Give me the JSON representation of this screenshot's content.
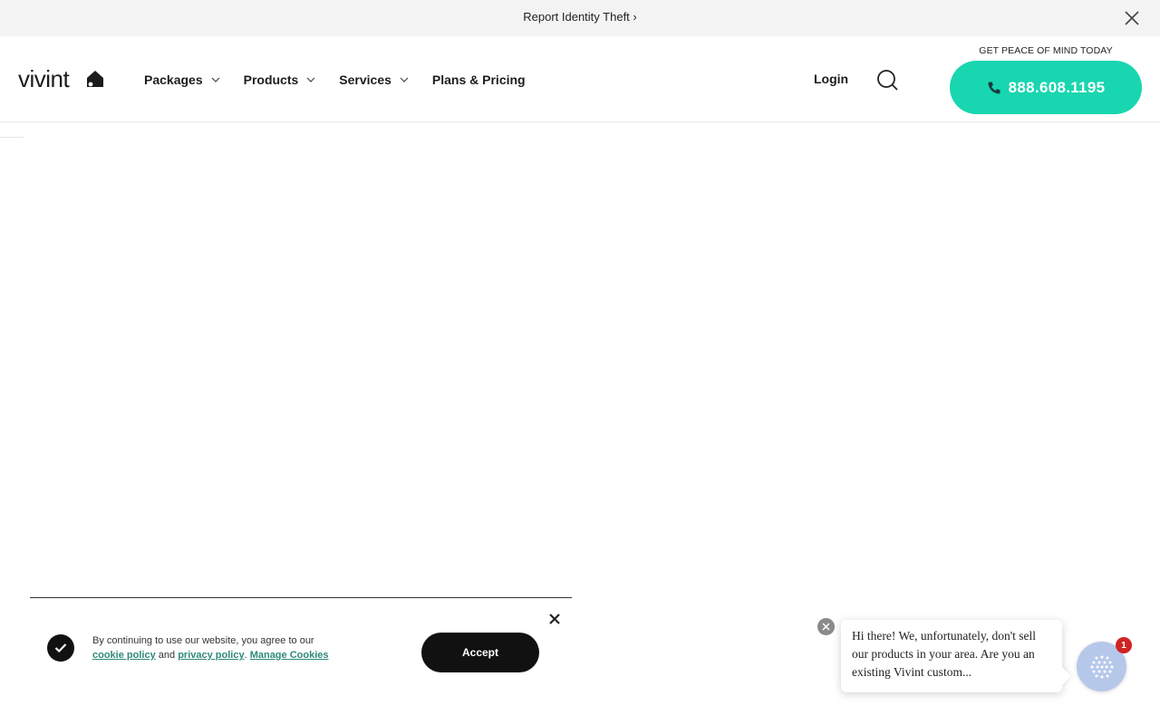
{
  "top_banner": {
    "link_text": "Report Identity Theft ›",
    "close_icon": "close-icon"
  },
  "header": {
    "logo_text": "vivint",
    "logo_icon": "house-icon",
    "nav": [
      {
        "label": "Packages",
        "has_dropdown": true
      },
      {
        "label": "Products",
        "has_dropdown": true
      },
      {
        "label": "Services",
        "has_dropdown": true
      },
      {
        "label": "Plans & Pricing",
        "has_dropdown": false
      }
    ],
    "login_label": "Login",
    "search_icon": "search-icon",
    "cta_label": "GET PEACE OF MIND TODAY",
    "phone_number": "888.608.1195",
    "phone_icon": "phone-icon"
  },
  "cookie_banner": {
    "text_prefix": "By continuing to use our website, you agree to our",
    "cookie_policy_label": "cookie policy",
    "and_text": "and",
    "privacy_policy_label": "privacy policy",
    "separator": ".",
    "manage_cookies_label": "Manage Cookies",
    "accept_label": "Accept"
  },
  "chat": {
    "message": "Hi there! We, unfortunately, don't sell our products in your area. Are you an existing Vivint custom...",
    "badge_count": "1"
  },
  "colors": {
    "accent": "#18d6b0",
    "banner_bg": "#f3f3f3",
    "link": "#2f8a7a",
    "badge": "#d02424",
    "chat_launcher": "#b6c8ea"
  }
}
